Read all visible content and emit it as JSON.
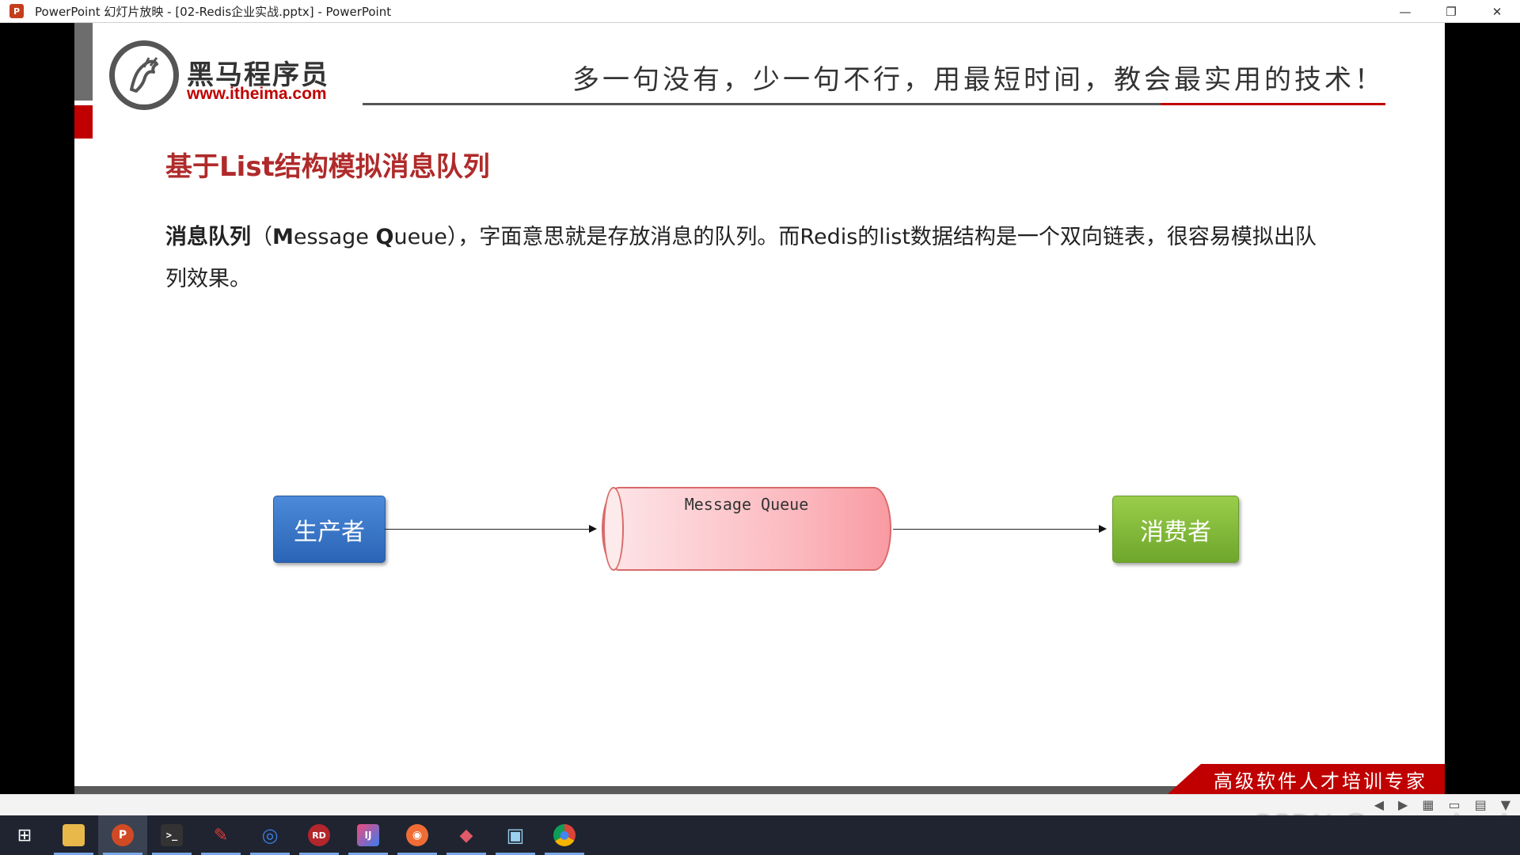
{
  "window": {
    "title": "PowerPoint 幻灯片放映 - [02-Redis企业实战.pptx] - PowerPoint",
    "app_icon_letter": "P",
    "minimize_glyph": "—",
    "restore_glyph": "❐",
    "close_glyph": "✕"
  },
  "slide": {
    "logo_title": "黑马程序员",
    "logo_url": "www.itheima.com",
    "slogan": "多一句没有，少一句不行，用最短时间，教会最实用的技术！",
    "heading": "基于List结构模拟消息队列",
    "body_bold_1": "消息队列",
    "body_paren_open": "（",
    "body_bold_m": "M",
    "body_essage": "essage ",
    "body_bold_q": "Q",
    "body_ueue": "ueue",
    "body_rest": "），字面意思就是存放消息的队列。而Redis的list数据结构是一个双向链表，很容易模拟出队列效果。",
    "diagram": {
      "producer": "生产者",
      "queue": "Message Queue",
      "consumer": "消费者"
    },
    "footer_banner": "高级软件人才培训专家"
  },
  "watermark": "CSDN @wang_book",
  "colors": {
    "accent_red": "#c00000",
    "producer_blue": "#2a64b6",
    "consumer_green": "#6ea72c",
    "queue_pink": "#fbb7bd"
  },
  "taskbar": {
    "items": [
      {
        "name": "start-icon",
        "glyph": "⊞"
      },
      {
        "name": "file-explorer-icon",
        "glyph": "📁"
      },
      {
        "name": "powerpoint-icon",
        "glyph": "P"
      },
      {
        "name": "terminal-icon",
        "glyph": ">_"
      },
      {
        "name": "pen-app-icon",
        "glyph": "✎"
      },
      {
        "name": "browser-app-icon",
        "glyph": "◎"
      },
      {
        "name": "redis-desktop-icon",
        "glyph": "RD"
      },
      {
        "name": "intellij-icon",
        "glyph": "IJ"
      },
      {
        "name": "postman-icon",
        "glyph": "◉"
      },
      {
        "name": "draw-app-icon",
        "glyph": "◆"
      },
      {
        "name": "screen-capture-icon",
        "glyph": "▣"
      },
      {
        "name": "chrome-icon",
        "glyph": "●"
      }
    ]
  }
}
